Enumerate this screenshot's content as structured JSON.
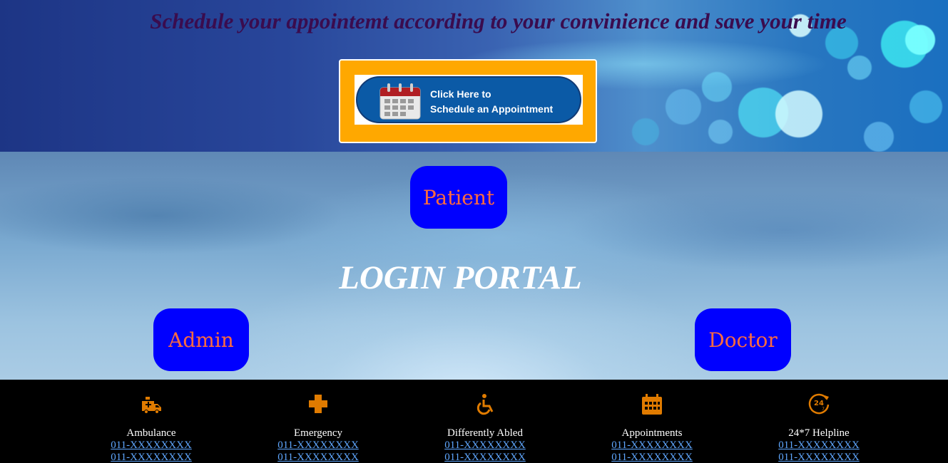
{
  "header": {
    "tagline": "Schedule your appointemt according to your convinience and save your time",
    "appointment_button": {
      "line1": "Click Here to",
      "line2": "Schedule an Appointment",
      "icon": "calendar-icon"
    }
  },
  "login": {
    "title": "LOGIN PORTAL",
    "patient_label": "Patient",
    "admin_label": "Admin",
    "doctor_label": "Doctor"
  },
  "footer": {
    "items": [
      {
        "label": "Ambulance",
        "icon": "ambulance-icon",
        "phone1": "011-XXXXXXXX",
        "phone2": "011-XXXXXXXX"
      },
      {
        "label": "Emergency",
        "icon": "medical-cross-icon",
        "phone1": "011-XXXXXXXX",
        "phone2": "011-XXXXXXXX"
      },
      {
        "label": "Differently Abled",
        "icon": "wheelchair-icon",
        "phone1": "011-XXXXXXXX",
        "phone2": "011-XXXXXXXX"
      },
      {
        "label": "Appointments",
        "icon": "calendar-icon",
        "phone1": "011-XXXXXXXX",
        "phone2": "011-XXXXXXXX"
      },
      {
        "label": "24*7 Helpline",
        "icon": "24-7-helpline-icon",
        "phone1": "011-XXXXXXXX",
        "phone2": "011-XXXXXXXX"
      }
    ]
  },
  "colors": {
    "tagline": "#3a0c4e",
    "appointment_frame": "#ffa800",
    "role_button_bg": "#0000ff",
    "role_button_text": "#ff6b3d",
    "footer_icon": "#e07b00",
    "footer_link": "#5fa7ff"
  }
}
